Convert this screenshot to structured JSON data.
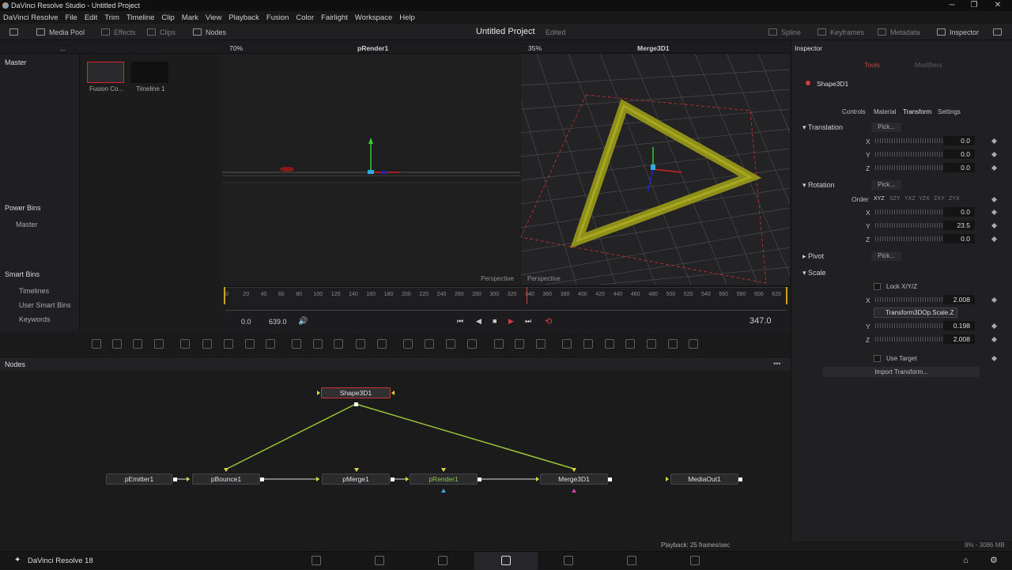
{
  "window": {
    "title": "DaVinci Resolve Studio - Untitled Project",
    "controls": [
      "─",
      "❐",
      "✕"
    ]
  },
  "menu": [
    "DaVinci Resolve",
    "File",
    "Edit",
    "Trim",
    "Timeline",
    "Clip",
    "Mark",
    "View",
    "Playback",
    "Fusion",
    "Color",
    "Fairlight",
    "Workspace",
    "Help"
  ],
  "toolbar": {
    "media_pool": "Media Pool",
    "effects": "Effects",
    "clips": "Clips",
    "nodes": "Nodes",
    "project_title": "Untitled Project",
    "edited": "Edited",
    "spline": "Spline",
    "keyframes": "Keyframes",
    "metadata": "Metadata",
    "inspector": "Inspector"
  },
  "viewer_bar": {
    "zoom_left": "70%",
    "name_left": "pRender1",
    "zoom_right": "35%",
    "name_right": "Merge3D1",
    "ellipsis": "..."
  },
  "leftpanel": {
    "master": "Master",
    "power_bins": "Power Bins",
    "power_master": "Master",
    "smart_bins": "Smart Bins",
    "timelines": "Timelines",
    "user_smart_bins": "User Smart Bins",
    "keywords": "Keywords"
  },
  "media": [
    {
      "label": "Fusion Co..."
    },
    {
      "label": "Timeline 1"
    }
  ],
  "viewers": {
    "left_label": "Perspective",
    "right_label": "Perspective"
  },
  "ruler_ticks": [
    "0",
    "20",
    "40",
    "60",
    "80",
    "100",
    "120",
    "140",
    "160",
    "180",
    "200",
    "220",
    "240",
    "260",
    "280",
    "300",
    "320",
    "340",
    "360",
    "380",
    "400",
    "420",
    "440",
    "460",
    "480",
    "500",
    "520",
    "540",
    "560",
    "580",
    "600",
    "620"
  ],
  "transport": {
    "start": "0.0",
    "end": "639.0",
    "current": "347.0"
  },
  "nodes": {
    "header": "Nodes",
    "more": "•••",
    "list": [
      {
        "id": "shape",
        "label": "Shape3D1"
      },
      {
        "id": "emitter",
        "label": "pEmitter1"
      },
      {
        "id": "bounce",
        "label": "pBounce1"
      },
      {
        "id": "merge",
        "label": "pMerge1"
      },
      {
        "id": "render",
        "label": "pRender1"
      },
      {
        "id": "merge3d",
        "label": "Merge3D1"
      },
      {
        "id": "out",
        "label": "MediaOut1"
      }
    ]
  },
  "inspector": {
    "title": "Inspector",
    "tab_tools": "Tools",
    "tab_modifiers": "Modifiers",
    "tool_name": "Shape3D1",
    "subtabs": [
      "Controls",
      "Material",
      "Transform",
      "Settings"
    ],
    "translation": {
      "label": "Translation",
      "pick": "Pick...",
      "x": "0.0",
      "y": "0.0",
      "z": "0.0"
    },
    "rotation": {
      "label": "Rotation",
      "pick": "Pick...",
      "order_label": "Order",
      "orders": [
        "XYZ",
        "XZY",
        "YXZ",
        "YZX",
        "ZXY",
        "ZYX"
      ],
      "x": "0.0",
      "y": "23.5",
      "z": "0.0"
    },
    "pivot": {
      "label": "Pivot",
      "pick": "Pick..."
    },
    "scale": {
      "label": "Scale",
      "lock": "Lock X/Y/Z",
      "x": "2.008",
      "tooltip": "Transform3DOp.Scale.Z",
      "y": "0.198",
      "z": "2.008"
    },
    "use_target": "Use Target",
    "import_transform": "Import Transform...",
    "axis": {
      "x": "X",
      "y": "Y",
      "z": "Z"
    }
  },
  "status": {
    "playback": "Playback: 25 frames/sec",
    "memory": "9% - 3086 MB"
  },
  "pagebar": {
    "app": "DaVinci Resolve 18"
  },
  "colors": {
    "accent_red": "#d23c3c",
    "selected_green": "#8cc63f",
    "link": "#9cc43a"
  }
}
